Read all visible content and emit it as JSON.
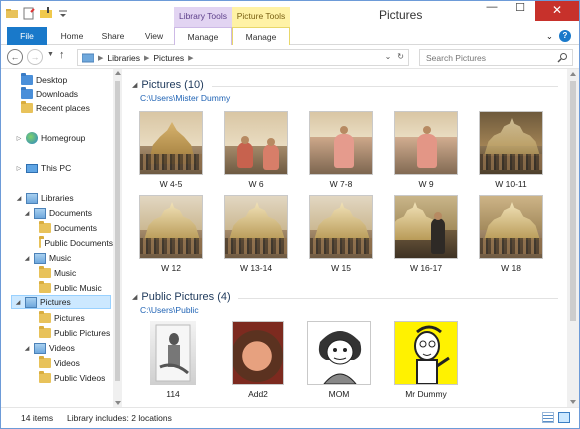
{
  "window": {
    "title": "Pictures",
    "minimize": "—",
    "maximize": "☐",
    "close": "✕"
  },
  "ribbon": {
    "context_library": "Library Tools",
    "context_picture": "Picture Tools",
    "tabs": [
      {
        "label": "File"
      },
      {
        "label": "Home"
      },
      {
        "label": "Share"
      },
      {
        "label": "View"
      },
      {
        "label": "Manage"
      },
      {
        "label": "Manage"
      }
    ],
    "expand": "⌄",
    "help": "?"
  },
  "address": {
    "crumbs": [
      "Libraries",
      "Pictures"
    ],
    "search_placeholder": "Search Pictures"
  },
  "nav": {
    "items": [
      {
        "label": "Desktop"
      },
      {
        "label": "Downloads"
      },
      {
        "label": "Recent places"
      },
      {
        "label": "Homegroup"
      },
      {
        "label": "This PC"
      },
      {
        "label": "Libraries"
      },
      {
        "label": "Documents"
      },
      {
        "label": "Documents"
      },
      {
        "label": "Public Documents"
      },
      {
        "label": "Music"
      },
      {
        "label": "Music"
      },
      {
        "label": "Public Music"
      },
      {
        "label": "Pictures"
      },
      {
        "label": "Pictures"
      },
      {
        "label": "Public Pictures"
      },
      {
        "label": "Videos"
      },
      {
        "label": "Videos"
      },
      {
        "label": "Public Videos"
      }
    ]
  },
  "groups": [
    {
      "title": "Pictures (10)",
      "path": "C:\\Users\\Mister Dummy",
      "items": [
        "W 4-5",
        "W 6",
        "W 7-8",
        "W 9",
        "W 10-11",
        "W 12",
        "W 13-14",
        "W 15",
        "W 16-17",
        "W 18"
      ]
    },
    {
      "title": "Public Pictures (4)",
      "path": "C:\\Users\\Public",
      "items": [
        "114",
        "Add2",
        "MOM",
        "Mr Dummy"
      ]
    }
  ],
  "status": {
    "count": "14 items",
    "library": "Library includes: 2 locations"
  },
  "colors": {
    "file_tab": "#1979ca",
    "library_tools": "#e2d4f2",
    "picture_tools": "#fff2a6",
    "group_title": "#1e395b",
    "path_link": "#1e62b4",
    "selection": "#cce8ff",
    "close_button": "#c7312b"
  },
  "icons": [
    "folder-icon",
    "properties-icon",
    "new-folder-icon",
    "customize-qat-icon",
    "refresh-icon",
    "search-icon",
    "help-icon"
  ]
}
